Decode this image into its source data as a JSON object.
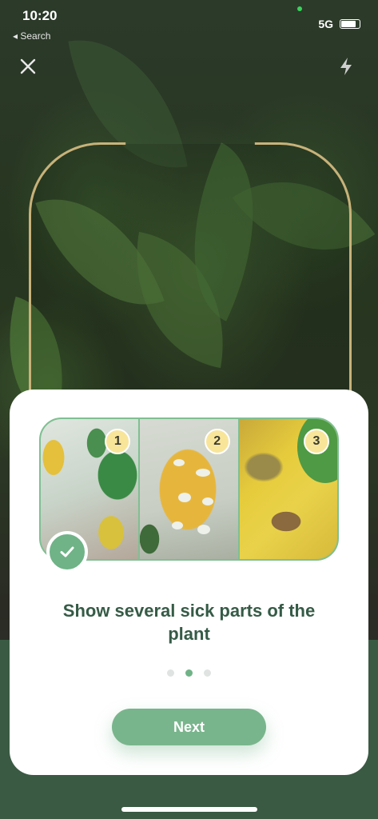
{
  "status_bar": {
    "time": "10:20",
    "back_label": "◂ Search",
    "network": "5G"
  },
  "camera": {
    "close_icon": "close-icon",
    "flash_icon": "flash-icon"
  },
  "card": {
    "photos": [
      {
        "number": "1"
      },
      {
        "number": "2"
      },
      {
        "number": "3"
      }
    ],
    "check_icon": "check-icon",
    "instruction": "Show several sick parts of the plant",
    "pager": {
      "total": 3,
      "active": 2
    },
    "next_label": "Next"
  },
  "colors": {
    "accent": "#6fb387",
    "title": "#355b46",
    "badge": "#f8e59a",
    "viewfinder": "#c8b27a"
  }
}
